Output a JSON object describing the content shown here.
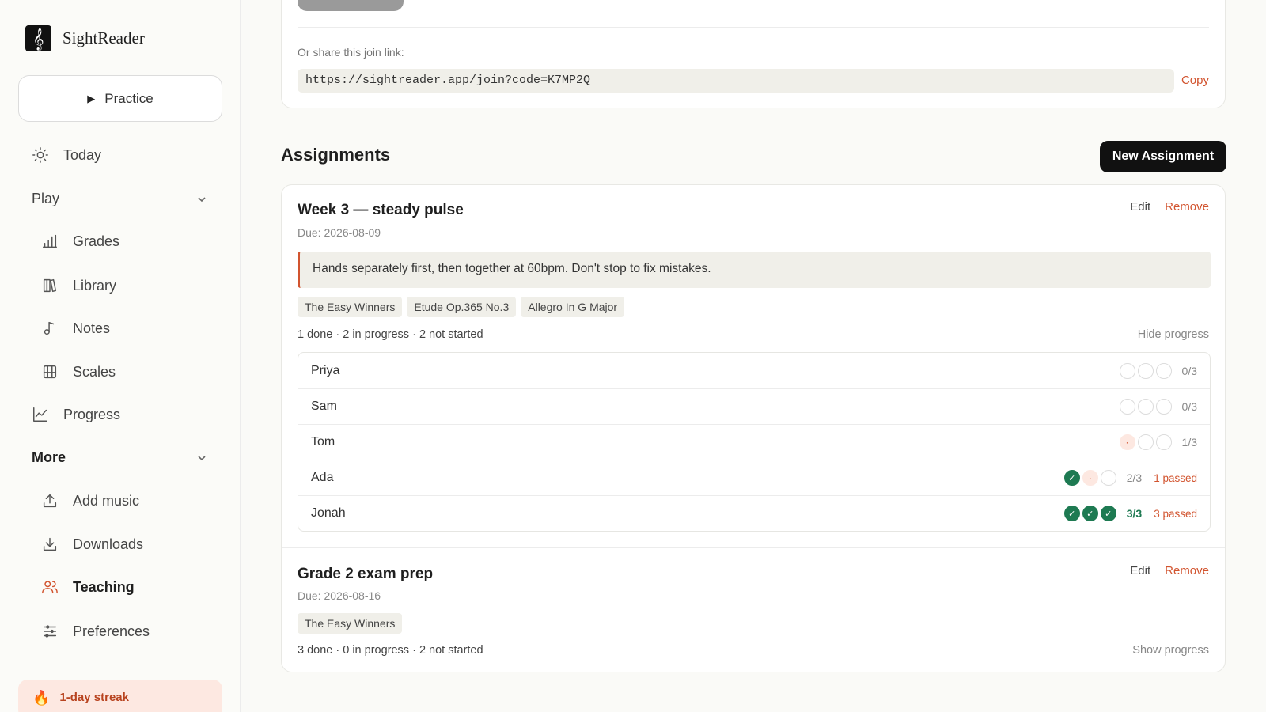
{
  "app": {
    "name": "SightReader",
    "logo_glyph": "𝄞"
  },
  "sidebar": {
    "practice_label": "Practice",
    "today_label": "Today",
    "play_group": "Play",
    "play_items": [
      {
        "label": "Grades"
      },
      {
        "label": "Library"
      },
      {
        "label": "Notes"
      },
      {
        "label": "Scales"
      }
    ],
    "progress_label": "Progress",
    "more_group": "More",
    "more_items": [
      {
        "label": "Add music"
      },
      {
        "label": "Downloads"
      },
      {
        "label": "Teaching"
      },
      {
        "label": "Preferences"
      }
    ],
    "active_item": "Teaching",
    "streak": "1-day streak"
  },
  "join": {
    "share_label": "Or share this join link:",
    "link": "https://sightreader.app/join?code=K7MP2Q",
    "copy_label": "Copy"
  },
  "assignments": {
    "title": "Assignments",
    "new_label": "New Assignment",
    "edit_label": "Edit",
    "remove_label": "Remove",
    "items": [
      {
        "title": "Week 3 — steady pulse",
        "due": "Due: 2026-08-09",
        "note": "Hands separately first, then together at 60bpm. Don't stop to fix mistakes.",
        "pieces": [
          "The Easy Winners",
          "Etude Op.365 No.3",
          "Allegro In G Major"
        ],
        "summary": "1 done · 2 in progress · 2 not started",
        "toggle": "Hide progress",
        "students": [
          {
            "name": "Priya",
            "marks": [
              "empty",
              "empty",
              "empty"
            ],
            "count": "0/3",
            "passed": ""
          },
          {
            "name": "Sam",
            "marks": [
              "empty",
              "empty",
              "empty"
            ],
            "count": "0/3",
            "passed": ""
          },
          {
            "name": "Tom",
            "marks": [
              "progress",
              "empty",
              "empty"
            ],
            "count": "1/3",
            "passed": ""
          },
          {
            "name": "Ada",
            "marks": [
              "done",
              "progress",
              "empty"
            ],
            "count": "2/3",
            "passed": "1 passed"
          },
          {
            "name": "Jonah",
            "marks": [
              "done",
              "done",
              "done"
            ],
            "count": "3/3",
            "passed": "3 passed"
          }
        ]
      },
      {
        "title": "Grade 2 exam prep",
        "due": "Due: 2026-08-16",
        "pieces": [
          "The Easy Winners"
        ],
        "summary": "3 done · 0 in progress · 2 not started",
        "toggle": "Show progress"
      }
    ]
  },
  "colors": {
    "accent": "#d2542f",
    "done": "#1e7a52",
    "tag_bg": "#f0efe9"
  }
}
